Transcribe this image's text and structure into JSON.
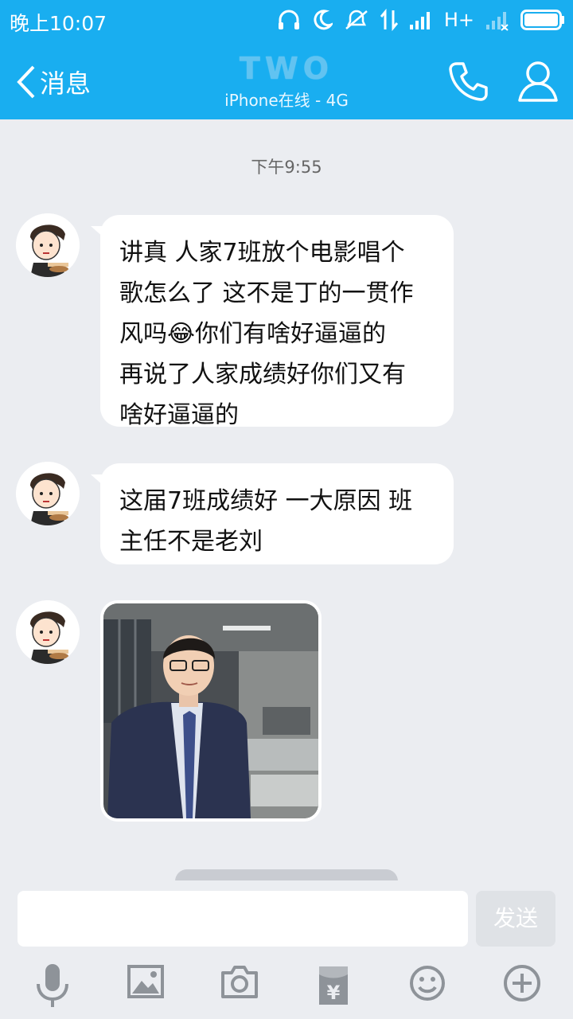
{
  "status": {
    "time": "晚上10:07",
    "network": "H+"
  },
  "nav": {
    "back_label": "消息",
    "title": "TWO",
    "subtitle": "iPhone在线 - 4G"
  },
  "chat": {
    "timestamp": "下午9:55",
    "messages": [
      {
        "lines": [
          "讲真 人家7班放个电影唱个",
          "歌怎么了 这不是丁的一贯作",
          "风吗😂你们有啥好逼逼的",
          "再说了人家成绩好你们又有",
          "啥好逼逼的"
        ]
      },
      {
        "lines": [
          "这届7班成绩好 一大原因 班",
          "主任不是老刘"
        ]
      }
    ]
  },
  "composer": {
    "input_value": "",
    "send_label": "发送"
  },
  "colors": {
    "header": "#19aef0",
    "background": "#ebedf1",
    "bubble": "#ffffff"
  },
  "icons": [
    "microphone-icon",
    "image-icon",
    "camera-icon",
    "red-packet-icon",
    "emoji-icon",
    "plus-icon"
  ]
}
